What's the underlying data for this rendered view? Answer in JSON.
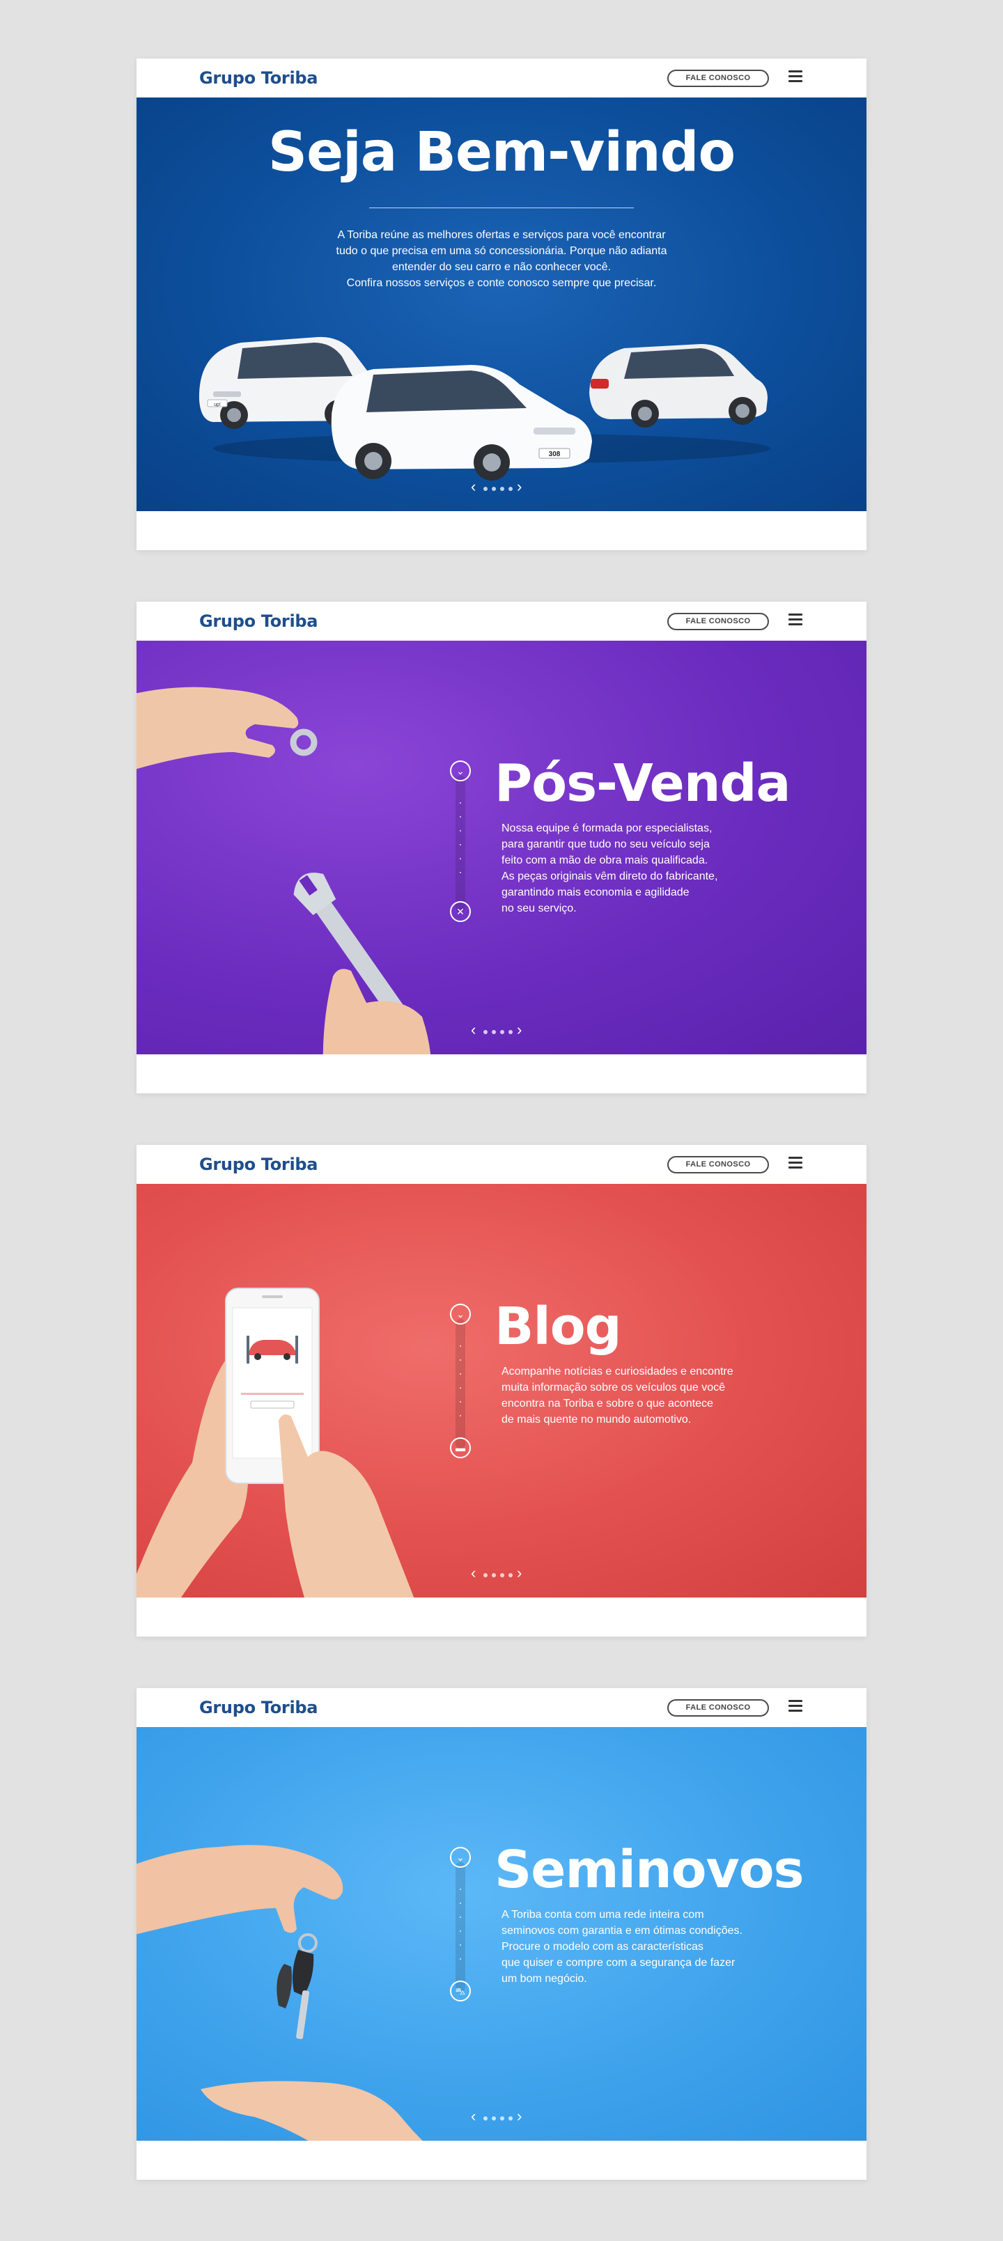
{
  "header": {
    "logo": "Grupo Toriba",
    "contact_button": "FALE CONOSCO"
  },
  "screens": [
    {
      "title": "Seja Bem-vindo",
      "description": "A Toriba reúne as melhores ofertas e serviços para você encontrar\ntudo o que precisa em uma só concessionária. Porque não adianta\nentender do seu carro e não conhecer você.\nConfira nossos serviços e conte conosco sempre que precisar.",
      "license_plates": [
        "up!",
        "308"
      ]
    },
    {
      "title": "Pós-Venda",
      "description": "Nossa equipe é formada por especialistas,\npara garantir que tudo no seu veículo seja\nfeito com a mão de obra mais qualificada.\nAs peças originais vêm direto do fabricante,\ngarantindo mais economia e agilidade\nno seu serviço.",
      "nav_icon": "wrench-cross-icon"
    },
    {
      "title": "Blog",
      "description": "Acompanhe notícias e curiosidades e encontre\nmuita informação sobre os veículos que você\nencontra na Toriba e sobre o que acontece\nde mais quente no mundo automotivo.",
      "nav_icon": "chat-bubble-icon"
    },
    {
      "title": "Seminovos",
      "description": "A Toriba conta com uma rede inteira com\nseminovos com garantia e em ótimas condições.\nProcure o modelo com as características\nque quiser e compre com a segurança de fazer\num bom negócio.",
      "nav_icon": "car-icon"
    }
  ],
  "pagination": {
    "prev": "‹",
    "next": "›",
    "dots": 4
  },
  "colors": {
    "brand": "#1e4e8c",
    "screen_1": "#0d4f9c",
    "screen_2": "#6b2cbf",
    "screen_3": "#e2504f",
    "screen_4": "#3fa3ec"
  }
}
